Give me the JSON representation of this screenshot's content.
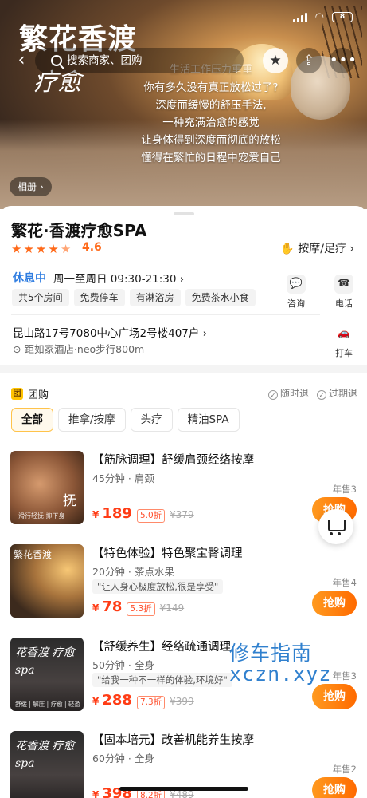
{
  "hero": {
    "brand_line1": "繁花香渡",
    "brand_line2": "疗愈",
    "poem": [
      "生活工作压力重重",
      "你有多久没有真正放松过了?",
      "深度而缓慢的舒压手法,",
      "一种充满治愈的感觉",
      "让身体得到深度而彻底的放松",
      "懂得在繁忙的日程中宠爱自己"
    ],
    "album_label": "相册 ›"
  },
  "status_bar": {
    "battery": "8"
  },
  "nav": {
    "back_icon": "‹",
    "search_placeholder": "搜索商家、团购",
    "favorite_icon": "★",
    "share_icon": "⇪",
    "more_icon": "•••"
  },
  "shop": {
    "title": "繁花·香渡疗愈SPA",
    "stars": [
      "★",
      "★",
      "★",
      "★",
      "★"
    ],
    "rating": "4.6",
    "category": "按摩/足疗 ›",
    "category_icon": "✋",
    "open_status": "休息中",
    "hours": "周一至周日 09:30-21:30 ›",
    "tags": [
      "共5个房间",
      "免费停车",
      "有淋浴房",
      "免费茶水小食"
    ],
    "consult_label": "咨询",
    "consult_icon": "💬",
    "call_label": "电话",
    "call_icon": "☎",
    "address": "昆山路17号7080中心广场2号楼407户 ›",
    "distance": "距如家酒店·neo步行800m",
    "taxi_label": "打车",
    "taxi_icon": "🚗"
  },
  "group_buy": {
    "badge": "团",
    "title": "团购",
    "policies": [
      "随时退",
      "过期退"
    ],
    "filters": [
      "全部",
      "推拿/按摩",
      "头疗",
      "精油SPA"
    ]
  },
  "deals": [
    {
      "title": "【筋脉调理】舒缓肩颈经络按摩",
      "sub": "45分钟 · 肩颈",
      "quote": "",
      "price": "189",
      "discount": "5.0折",
      "original": "¥379",
      "sold": "年售3",
      "buy": "抢购",
      "thumb_text": "抚",
      "thumb_caption": "滑行轻抚 抑下身"
    },
    {
      "title": "【特色体验】特色聚宝臀调理",
      "sub": "20分钟 · 茶点水果",
      "quote": "\"让人身心极度放松,很是享受\"",
      "price": "78",
      "discount": "5.3折",
      "original": "¥149",
      "sold": "年售4",
      "buy": "抢购",
      "thumb_text": "繁花香渡",
      "thumb_caption": ""
    },
    {
      "title": "【舒缓养生】经络疏通调理",
      "sub": "50分钟 · 全身",
      "quote": "\"给我一种不一样的体验,环境好\"",
      "price": "288",
      "discount": "7.3折",
      "original": "¥399",
      "sold": "年售3",
      "buy": "抢购",
      "thumb_text": "花香渡 疗愈spa",
      "thumb_caption": "舒缓 | 解压 | 疗愈 | 轻盈"
    },
    {
      "title": "【固本培元】改善机能养生按摩",
      "sub": "60分钟 · 全身",
      "quote": "",
      "price": "398",
      "discount": "8.2折",
      "original": "¥489",
      "sold": "年售2",
      "buy": "抢购",
      "thumb_text": "花香渡 疗愈spa",
      "thumb_caption": ""
    }
  ],
  "currency": "¥",
  "watermark": [
    "修车指南",
    "xczn.xyz"
  ]
}
